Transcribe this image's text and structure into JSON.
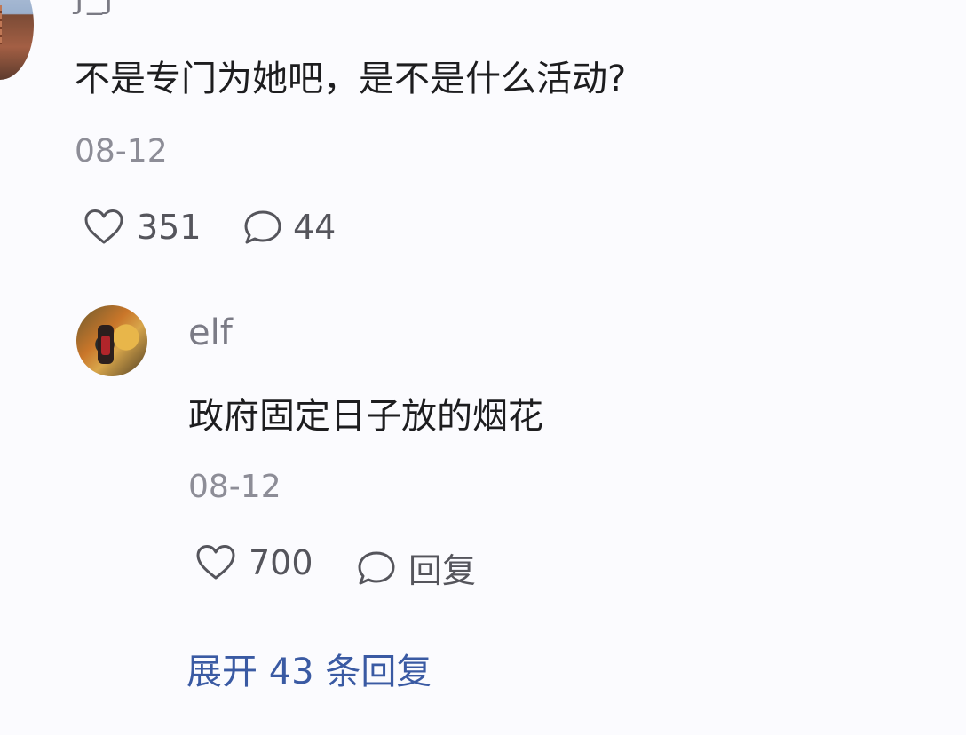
{
  "top_comment": {
    "username": "ƒ_ƒ",
    "text": "不是专门为她吧，是不是什么活动?",
    "date": "08-12",
    "like_count": "351",
    "reply_count": "44"
  },
  "reply": {
    "username": "elf",
    "text": "政府固定日子放的烟花",
    "date": "08-12",
    "like_count": "700",
    "reply_label": "回复"
  },
  "expand_replies": {
    "label": "展开 43 条回复"
  },
  "icons": {
    "like": "heart-outline-icon",
    "comment": "speech-bubble-icon"
  },
  "colors": {
    "background": "#fbfbfe",
    "text": "#1d1d1f",
    "muted": "#8d8d97",
    "link": "#3a5aa3"
  }
}
